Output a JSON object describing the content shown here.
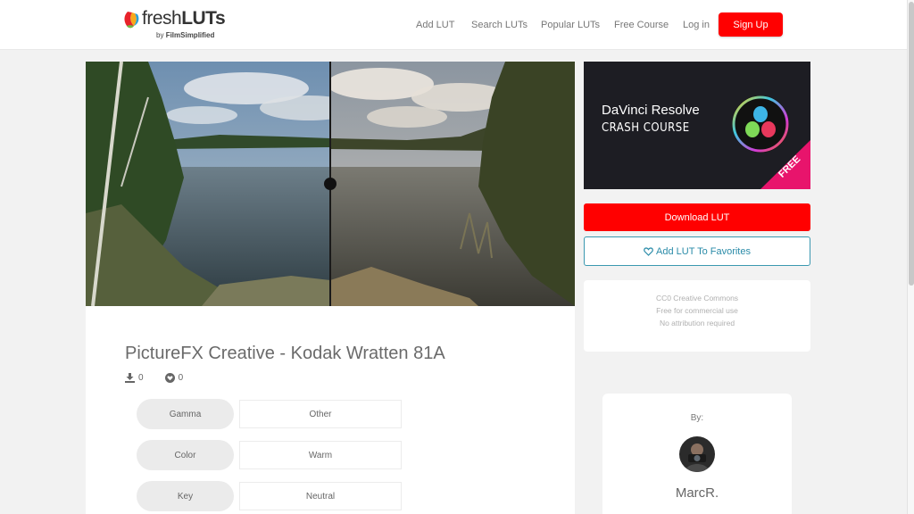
{
  "brand": {
    "name_light": "fresh",
    "name_bold": "LUTs",
    "by_text": "by",
    "by_brand": "FilmSimplified"
  },
  "nav": {
    "add_lut": "Add LUT",
    "search_luts": "Search LUTs",
    "popular_luts": "Popular LUTs",
    "free_course": "Free Course",
    "log_in": "Log in",
    "sign_up": "Sign Up"
  },
  "lut": {
    "title": "PictureFX Creative - Kodak Wratten 81A",
    "downloads": "0",
    "favorites": "0",
    "properties": [
      {
        "key": "Gamma",
        "value": "Other"
      },
      {
        "key": "Color",
        "value": "Warm"
      },
      {
        "key": "Key",
        "value": "Neutral"
      }
    ],
    "comparison_split": 0.5
  },
  "ad": {
    "title": "DaVinci Resolve",
    "subtitle": "CRASH COURSE",
    "ribbon": "FREE"
  },
  "actions": {
    "download": "Download LUT",
    "favorite": "Add LUT To Favorites"
  },
  "license": {
    "line1": "CC0 Creative Commons",
    "line2": "Free for commercial use",
    "line3": "No attribution required"
  },
  "author": {
    "by_label": "By:",
    "name": "MarcR."
  },
  "colors": {
    "primary_red": "#ff0000",
    "favorite_blue": "#2a8ba8",
    "ribbon_pink": "#e8146c"
  }
}
